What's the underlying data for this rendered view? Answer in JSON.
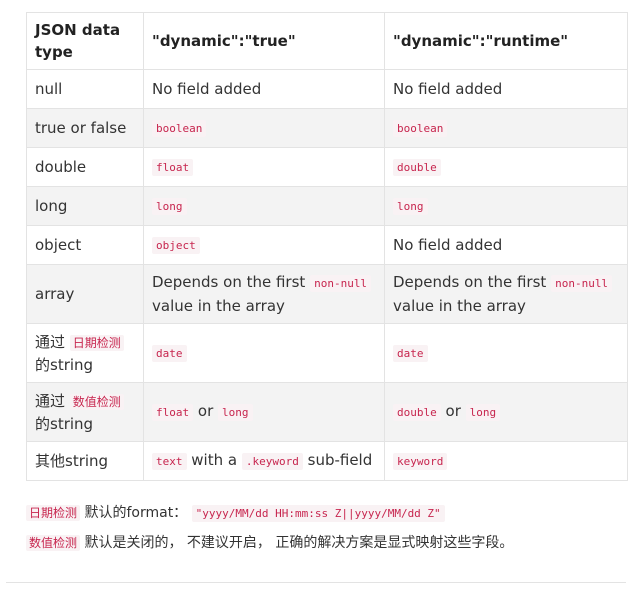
{
  "table": {
    "headers": [
      "JSON data type",
      "\"dynamic\":\"true\"",
      "\"dynamic\":\"runtime\""
    ],
    "rows": [
      {
        "type": "null",
        "true_text": "No field added",
        "runtime_text": "No field added"
      },
      {
        "type": "true or false",
        "true_code": "boolean",
        "runtime_code": "boolean"
      },
      {
        "type": "double",
        "true_code": "float",
        "runtime_code": "double"
      },
      {
        "type": "long",
        "true_code": "long",
        "runtime_code": "long"
      },
      {
        "type": "object",
        "true_code": "object",
        "runtime_text": "No field added"
      },
      {
        "type": "array",
        "depends_pre": "Depends on the first",
        "depends_code": "non-null",
        "depends_post": "value in the array"
      },
      {
        "type_pre": "通过",
        "type_mark": "日期检测",
        "type_post": "的string",
        "true_code": "date",
        "runtime_code": "date"
      },
      {
        "type_pre": "通过",
        "type_mark": "数值检测",
        "type_post": "的string",
        "true_code_a": "float",
        "or_word": "or",
        "true_code_b": "long",
        "runtime_code_a": "double",
        "runtime_code_b": "long"
      },
      {
        "type": "其他string",
        "true_code": "text",
        "with_a": "with a",
        "keyword_code": ".keyword",
        "sub_field": "sub-field",
        "runtime_code": "keyword"
      }
    ]
  },
  "notes": {
    "date_mark": "日期检测",
    "date_text": "默认的format：",
    "date_format": "\"yyyy/MM/dd HH:mm:ss Z||yyyy/MM/dd Z\"",
    "numeric_mark": "数值检测",
    "numeric_text": "默认是关闭的， 不建议开启， 正确的解决方案是显式映射这些字段。"
  }
}
